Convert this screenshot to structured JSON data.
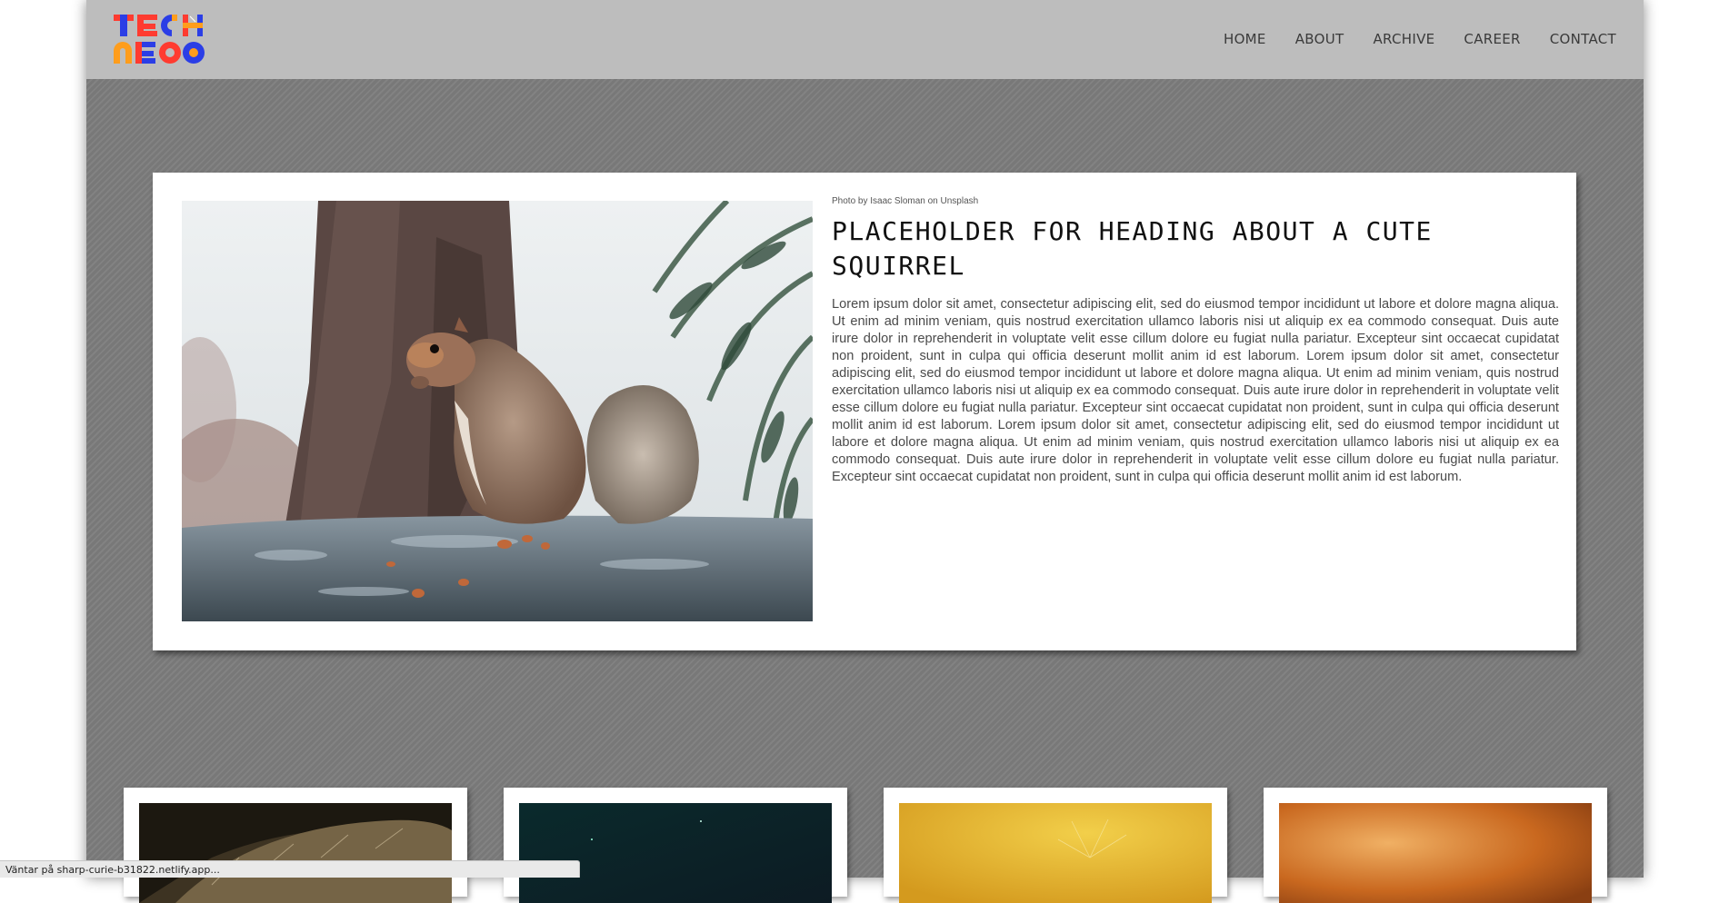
{
  "nav": {
    "logo_alt": "Tech Neo",
    "items": [
      {
        "label": "HOME"
      },
      {
        "label": "ABOUT"
      },
      {
        "label": "ARCHIVE"
      },
      {
        "label": "CAREER"
      },
      {
        "label": "CONTACT"
      }
    ]
  },
  "feature": {
    "photo_credit": "Photo by Isaac Sloman on Unsplash",
    "heading": "PLACEHOLDER FOR HEADING ABOUT A CUTE SQUIRREL",
    "body": "Lorem ipsum dolor sit amet, consectetur adipiscing elit, sed do eiusmod tempor incididunt ut labore et dolore magna aliqua. Ut enim ad minim veniam, quis nostrud exercitation ullamco laboris nisi ut aliquip ex ea commodo consequat. Duis aute irure dolor in reprehenderit in voluptate velit esse cillum dolore eu fugiat nulla pariatur. Excepteur sint occaecat cupidatat non proident, sunt in culpa qui officia deserunt mollit anim id est laborum. Lorem ipsum dolor sit amet, consectetur adipiscing elit, sed do eiusmod tempor incididunt ut labore et dolore magna aliqua. Ut enim ad minim veniam, quis nostrud exercitation ullamco laboris nisi ut aliquip ex ea commodo consequat. Duis aute irure dolor in reprehenderit in voluptate velit esse cillum dolore eu fugiat nulla pariatur. Excepteur sint occaecat cupidatat non proident, sunt in culpa qui officia deserunt mollit anim id est laborum. Lorem ipsum dolor sit amet, consectetur adipiscing elit, sed do eiusmod tempor incididunt ut labore et dolore magna aliqua. Ut enim ad minim veniam, quis nostrud exercitation ullamco laboris nisi ut aliquip ex ea commodo consequat. Duis aute irure dolor in reprehenderit in voluptate velit esse cillum dolore eu fugiat nulla pariatur. Excepteur sint occaecat cupidatat non proident, sunt in culpa qui officia deserunt mollit anim id est laborum."
  },
  "thumbnails": [
    {
      "subject": "cactus-spines"
    },
    {
      "subject": "dark-teal-sky"
    },
    {
      "subject": "yellow-dandelion"
    },
    {
      "subject": "orange-blur"
    }
  ],
  "status_bar": {
    "text": "Väntar på sharp-curie-b31822.netlify.app..."
  },
  "colors": {
    "navbar_bg": "#bdbdbd",
    "page_bg": "#7c7c7c",
    "logo_red": "#ff3b30",
    "logo_blue": "#2b3ee6",
    "logo_orange": "#ff9d1c"
  }
}
